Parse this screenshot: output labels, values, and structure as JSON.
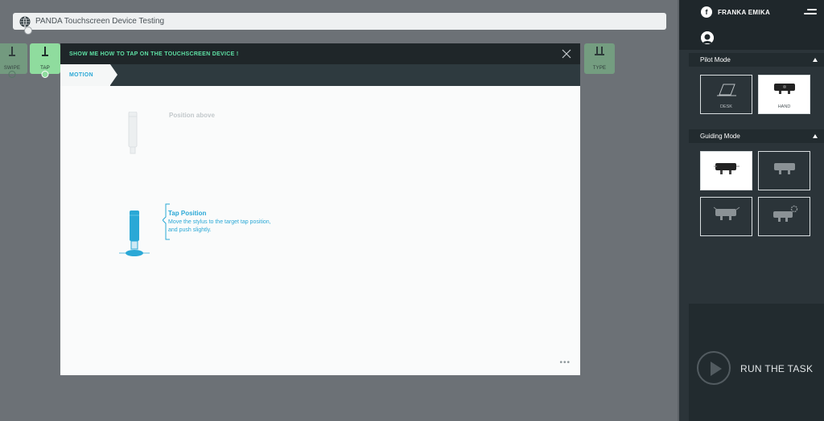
{
  "taskbar": {
    "title": "PANDA Touchscreen Device Testing"
  },
  "apps": [
    {
      "label": "SWIPE"
    },
    {
      "label": "TAP"
    },
    {
      "label": "TYPE"
    }
  ],
  "modal": {
    "question": "SHOW ME HOW TO TAP ON THE TOUCHSCREEN DEVICE !",
    "tab": "MOTION",
    "position_above": "Position above",
    "tap_title": "Tap Position",
    "tap_desc": "Move the stylus to the target tap position, and push slightly.",
    "more": "•••"
  },
  "panel": {
    "brand": "FRANKA EMIKA",
    "brand_logo": "f",
    "pilot_mode": "Pilot Mode",
    "pilot_options": [
      {
        "label": "DESK",
        "selected": false
      },
      {
        "label": "HAND",
        "selected": true
      }
    ],
    "guiding_mode": "Guiding Mode",
    "run_label": "RUN THE TASK"
  },
  "colors": {
    "accent": "#2aa8d6",
    "green": "#8fdc9e",
    "question": "#5ee0a4"
  }
}
